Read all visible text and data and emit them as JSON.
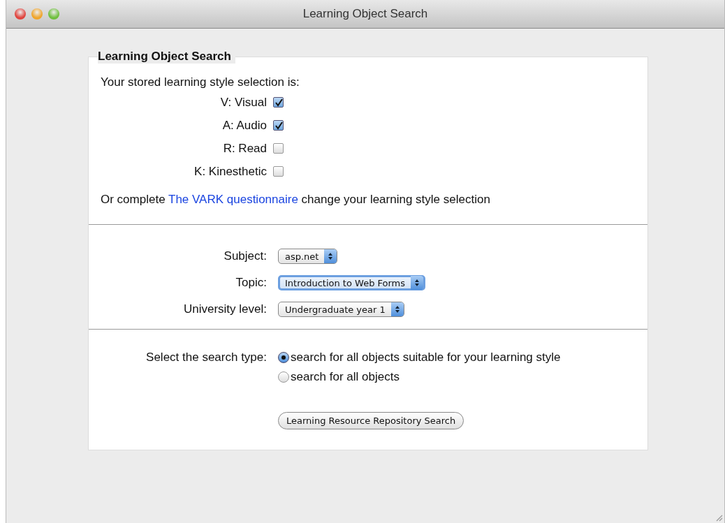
{
  "window": {
    "title": "Learning Object Search"
  },
  "form": {
    "legend": "Learning Object Search",
    "intro": "Your stored learning style selection is:",
    "styles": [
      {
        "label": "V: Visual",
        "checked": true
      },
      {
        "label": "A: Audio",
        "checked": true
      },
      {
        "label": "R: Read",
        "checked": false
      },
      {
        "label": "K: Kinesthetic",
        "checked": false
      }
    ],
    "note_before": "Or complete ",
    "note_link": "The VARK questionnaire",
    "note_after": " change your learning style selection",
    "selects": [
      {
        "label": "Subject:",
        "value": "asp.net",
        "focused": false
      },
      {
        "label": "Topic:",
        "value": "Introduction to Web Forms",
        "focused": true
      },
      {
        "label": "University level:",
        "value": "Undergraduate year 1",
        "focused": false
      }
    ],
    "search_type_label": "Select the search type:",
    "search_types": [
      {
        "label": "search for all objects suitable for your learning style",
        "selected": true
      },
      {
        "label": "search for all objects",
        "selected": false
      }
    ],
    "submit": "Learning Resource Repository Search"
  }
}
